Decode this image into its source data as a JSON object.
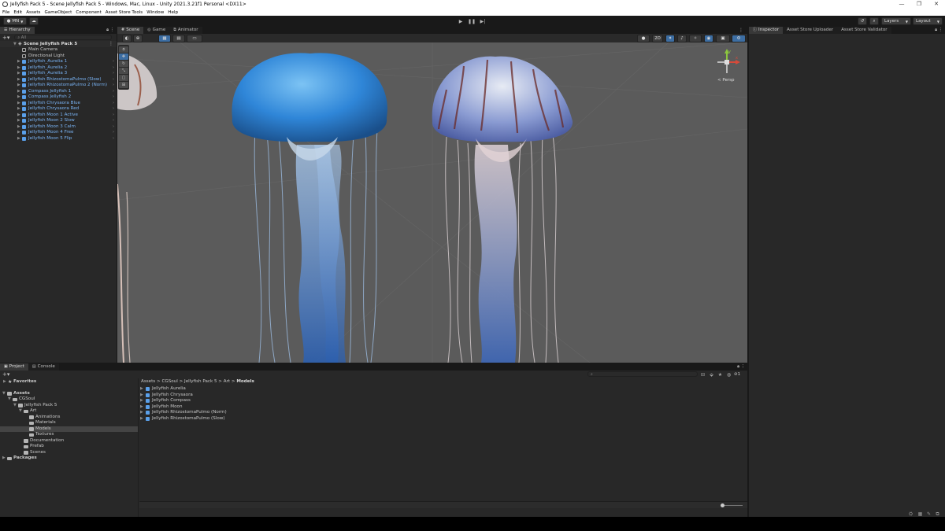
{
  "window": {
    "title": "Jellyfish Pack 5 - Scene Jellyfish Pack 5 - Windows, Mac, Linux - Unity 2021.3.21f1 Personal <DX11>",
    "controls": [
      "—",
      "❐",
      "✕"
    ]
  },
  "menu": [
    "File",
    "Edit",
    "Assets",
    "GameObject",
    "Component",
    "Asset Store Tools",
    "Window",
    "Help"
  ],
  "toolbar": {
    "account": "MN",
    "layers": "Layers",
    "layout": "Layout"
  },
  "hierarchy": {
    "tab": "Hierarchy",
    "search_placeholder": "All",
    "scene": "Scene Jellyfish Pack 5",
    "items": [
      {
        "label": "Main Camera",
        "blue": false,
        "arrow": false
      },
      {
        "label": "Directional Light",
        "blue": false,
        "arrow": false
      },
      {
        "label": "Jellyfish_Aurelia 1",
        "blue": true,
        "arrow": true
      },
      {
        "label": "Jellyfish_Aurelia 2",
        "blue": true,
        "arrow": true
      },
      {
        "label": "Jellyfish_Aurelia 3",
        "blue": true,
        "arrow": true
      },
      {
        "label": "Jellyfish RhizostomaPulmo (Slow)",
        "blue": true,
        "arrow": true
      },
      {
        "label": "Jellyfish RhizostomaPulmo 2 (Norm)",
        "blue": true,
        "arrow": true
      },
      {
        "label": "Compass Jellyfish 1",
        "blue": true,
        "arrow": true
      },
      {
        "label": "Compass Jellyfish 2",
        "blue": true,
        "arrow": true
      },
      {
        "label": "Jellyfish Chrysaora Blue",
        "blue": true,
        "arrow": true
      },
      {
        "label": "Jellyfish Chrysaora Red",
        "blue": true,
        "arrow": true
      },
      {
        "label": "Jellyfish Moon 1 Active",
        "blue": true,
        "arrow": true
      },
      {
        "label": "Jellyfish Moon 2 Slow",
        "blue": true,
        "arrow": true
      },
      {
        "label": "Jellyfish Moon 3 Calm",
        "blue": true,
        "arrow": true
      },
      {
        "label": "Jellyfish Moon 4 Free",
        "blue": true,
        "arrow": true
      },
      {
        "label": "Jellyfish Moon 5 Flip",
        "blue": true,
        "arrow": true
      }
    ]
  },
  "scene_tabs": [
    "Scene",
    "Game",
    "Animator"
  ],
  "scene": {
    "mode_2d": "2D",
    "persp": "< Persp",
    "gizmo_axes": {
      "x": "x",
      "y": "y",
      "z": "z"
    }
  },
  "inspector_tabs": [
    "Inspector",
    "Asset Store Uploader",
    "Asset Store Validator"
  ],
  "bottom_tabs": [
    "Project",
    "Console"
  ],
  "project": {
    "favorites": "Favorites",
    "tree": [
      {
        "label": "Assets",
        "level": 0,
        "bold": true
      },
      {
        "label": "CGSoul",
        "level": 1,
        "bold": false
      },
      {
        "label": "Jellyfish Pack 5",
        "level": 2,
        "bold": false
      },
      {
        "label": "Art",
        "level": 3,
        "bold": false
      },
      {
        "label": "Animations",
        "level": 4,
        "bold": false
      },
      {
        "label": "Materials",
        "level": 4,
        "bold": false
      },
      {
        "label": "Models",
        "level": 4,
        "bold": false,
        "selected": true
      },
      {
        "label": "Textures",
        "level": 4,
        "bold": false
      },
      {
        "label": "Documentation",
        "level": 3,
        "bold": false
      },
      {
        "label": "Prefab",
        "level": 3,
        "bold": false
      },
      {
        "label": "Scenes",
        "level": 3,
        "bold": false
      },
      {
        "label": "Packages",
        "level": 0,
        "bold": true
      }
    ],
    "breadcrumb": [
      "Assets",
      "CGSoul",
      "Jellyfish Pack 5",
      "Art",
      "Models"
    ],
    "assets": [
      "Jellyfish Aurelia",
      "Jellyfish Chrysaora",
      "Jellyfish Compass",
      "Jellyfish Moon",
      "Jellyfish RhizostomaPulmo (Norm)",
      "Jellyfish RhizostomaPulmo (Slow)"
    ],
    "hidden_count": "1"
  },
  "colors": {
    "accent": "#3d6ea3",
    "prefab_blue": "#7ab4f5",
    "panel": "#282828",
    "scene_bg": "#5b5b5b"
  }
}
